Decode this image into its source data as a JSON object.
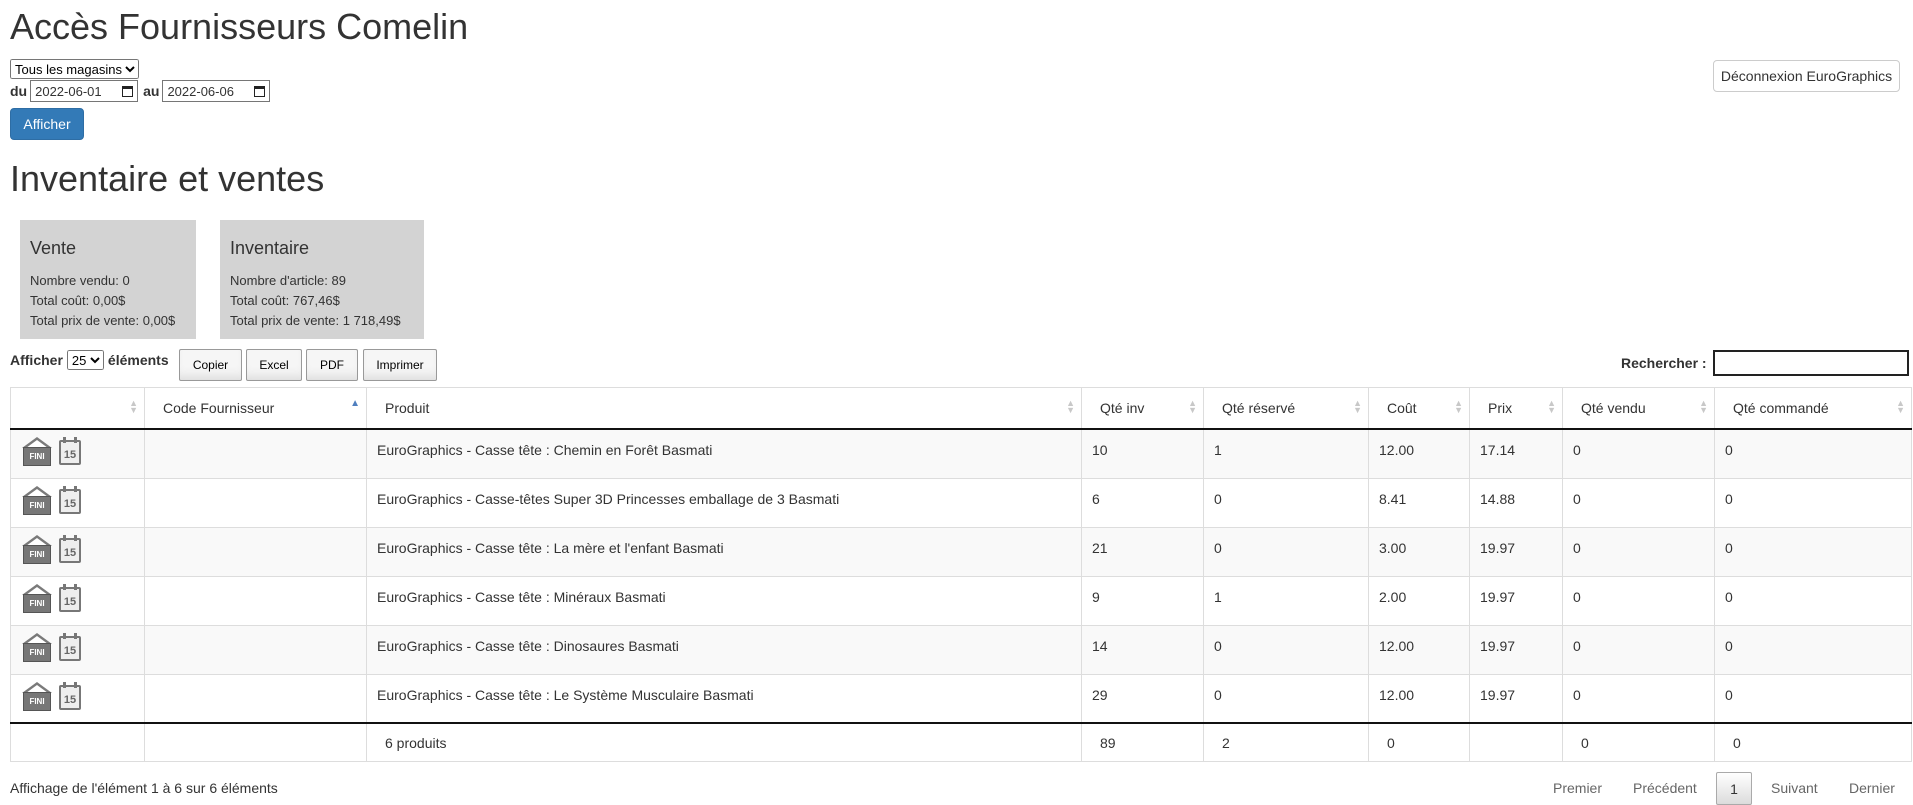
{
  "header": {
    "title": "Accès Fournisseurs Comelin",
    "store_select": "Tous les magasins",
    "from_label": "du",
    "from_date": "2022-06-01",
    "to_label": "au",
    "to_date": "2022-06-06",
    "show_button": "Afficher",
    "logout_button": "Déconnexion EuroGraphics"
  },
  "section_title": "Inventaire et ventes",
  "cards": {
    "sales": {
      "title": "Vente",
      "line1": "Nombre vendu: 0",
      "line2": "Total coût: 0,00$",
      "line3": "Total prix de vente: 0,00$"
    },
    "inventory": {
      "title": "Inventaire",
      "line1": "Nombre d'article: 89",
      "line2": "Total coût: 767,46$",
      "line3": "Total prix de vente: 1 718,49$"
    }
  },
  "table_controls": {
    "show_label": "Afficher",
    "length_value": "25",
    "elements_label": "éléments",
    "buttons": [
      "Copier",
      "Excel",
      "PDF",
      "Imprimer"
    ],
    "search_label": "Rechercher :"
  },
  "table": {
    "headers": [
      "",
      "Code Fournisseur",
      "Produit",
      "Qté inv",
      "Qté réservé",
      "Coût",
      "Prix",
      "Qté vendu",
      "Qté commandé"
    ],
    "icons": {
      "done": "FINI",
      "calendar": "15"
    },
    "rows": [
      {
        "code": "",
        "product": "EuroGraphics - Casse tête : Chemin en Forêt Basmati",
        "qty_inv": "10",
        "qty_reserved": "1",
        "cost": "12.00",
        "price": "17.14",
        "qty_sold": "0",
        "qty_ordered": "0"
      },
      {
        "code": "",
        "product": "EuroGraphics - Casse-têtes Super 3D Princesses emballage de 3 Basmati",
        "qty_inv": "6",
        "qty_reserved": "0",
        "cost": "8.41",
        "price": "14.88",
        "qty_sold": "0",
        "qty_ordered": "0"
      },
      {
        "code": "",
        "product": "EuroGraphics - Casse tête : La mère et l'enfant Basmati",
        "qty_inv": "21",
        "qty_reserved": "0",
        "cost": "3.00",
        "price": "19.97",
        "qty_sold": "0",
        "qty_ordered": "0"
      },
      {
        "code": "",
        "product": "EuroGraphics - Casse tête : Minéraux Basmati",
        "qty_inv": "9",
        "qty_reserved": "1",
        "cost": "2.00",
        "price": "19.97",
        "qty_sold": "0",
        "qty_ordered": "0"
      },
      {
        "code": "",
        "product": "EuroGraphics - Casse tête : Dinosaures Basmati",
        "qty_inv": "14",
        "qty_reserved": "0",
        "cost": "12.00",
        "price": "19.97",
        "qty_sold": "0",
        "qty_ordered": "0"
      },
      {
        "code": "",
        "product": "EuroGraphics - Casse tête : Le Système Musculaire Basmati",
        "qty_inv": "29",
        "qty_reserved": "0",
        "cost": "12.00",
        "price": "19.97",
        "qty_sold": "0",
        "qty_ordered": "0"
      }
    ],
    "footer": {
      "product_count": "6 produits",
      "qty_inv": "89",
      "qty_reserved": "2",
      "cost": "0",
      "qty_sold": "0",
      "qty_ordered": "0"
    }
  },
  "pagination": {
    "info": "Affichage de l'élément 1 à 6 sur 6 éléments",
    "first": "Premier",
    "previous": "Précédent",
    "current": "1",
    "next": "Suivant",
    "last": "Dernier"
  }
}
